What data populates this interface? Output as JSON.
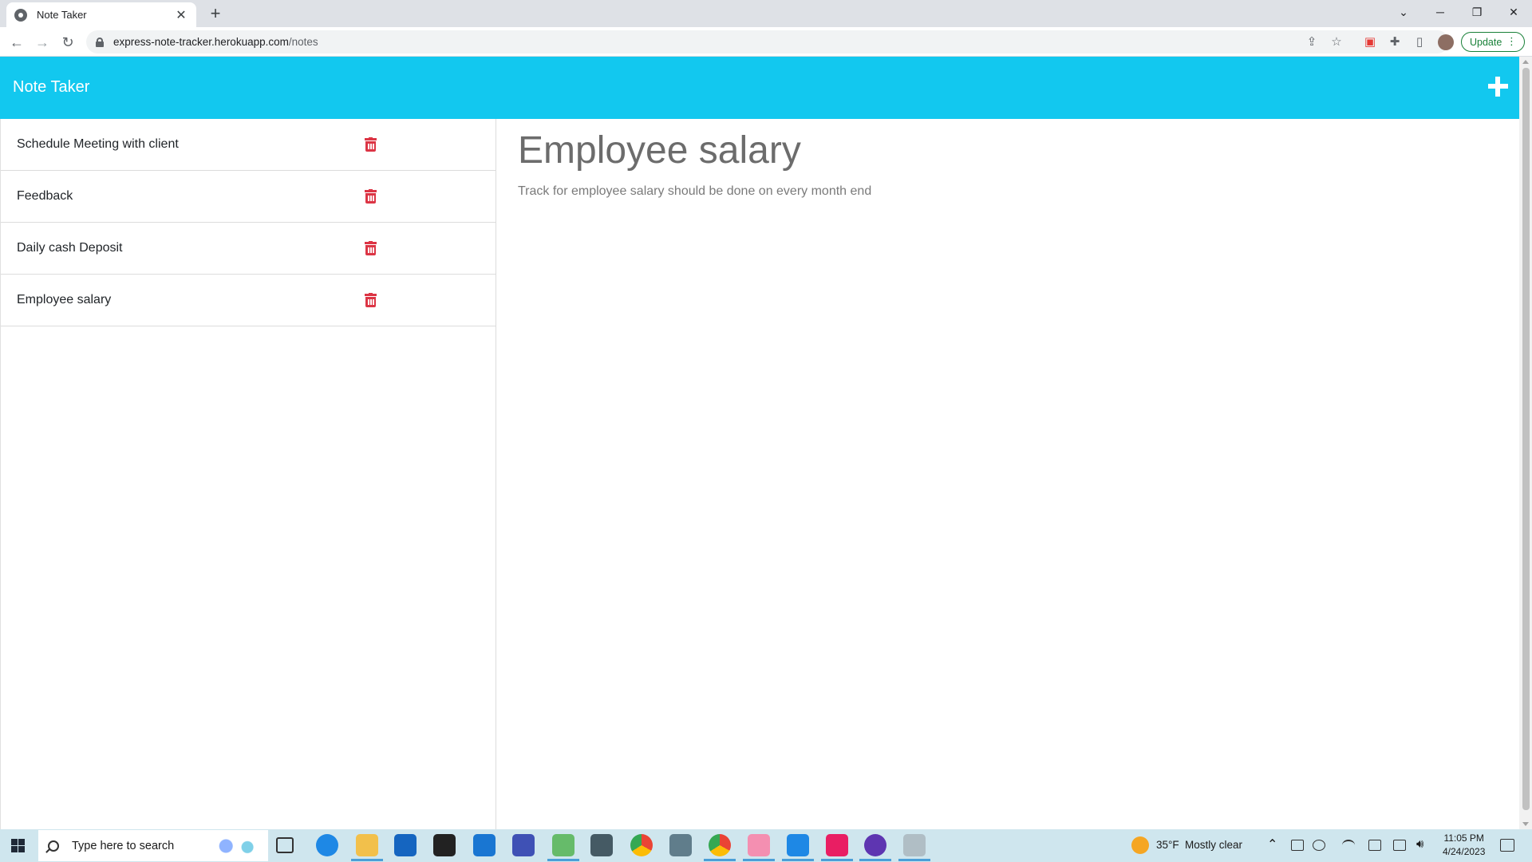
{
  "browser": {
    "tab_title": "Note Taker",
    "url_host": "express-note-tracker.herokuapp.com",
    "url_path": "/notes",
    "update_label": "Update"
  },
  "app": {
    "brand": "Note Taker",
    "notes": [
      {
        "title": "Schedule Meeting with client"
      },
      {
        "title": "Feedback"
      },
      {
        "title": "Daily cash Deposit"
      },
      {
        "title": "Employee salary"
      }
    ],
    "active_note": {
      "title": "Employee salary",
      "text": "Track for employee salary should be done on every month end"
    },
    "colors": {
      "navbar": "#12c8ef",
      "delete": "#dc3545"
    }
  },
  "taskbar": {
    "search_placeholder": "Type here to search",
    "weather_temp": "35°F",
    "weather_text": "Mostly clear",
    "time": "11:05 PM",
    "date": "4/24/2023"
  }
}
